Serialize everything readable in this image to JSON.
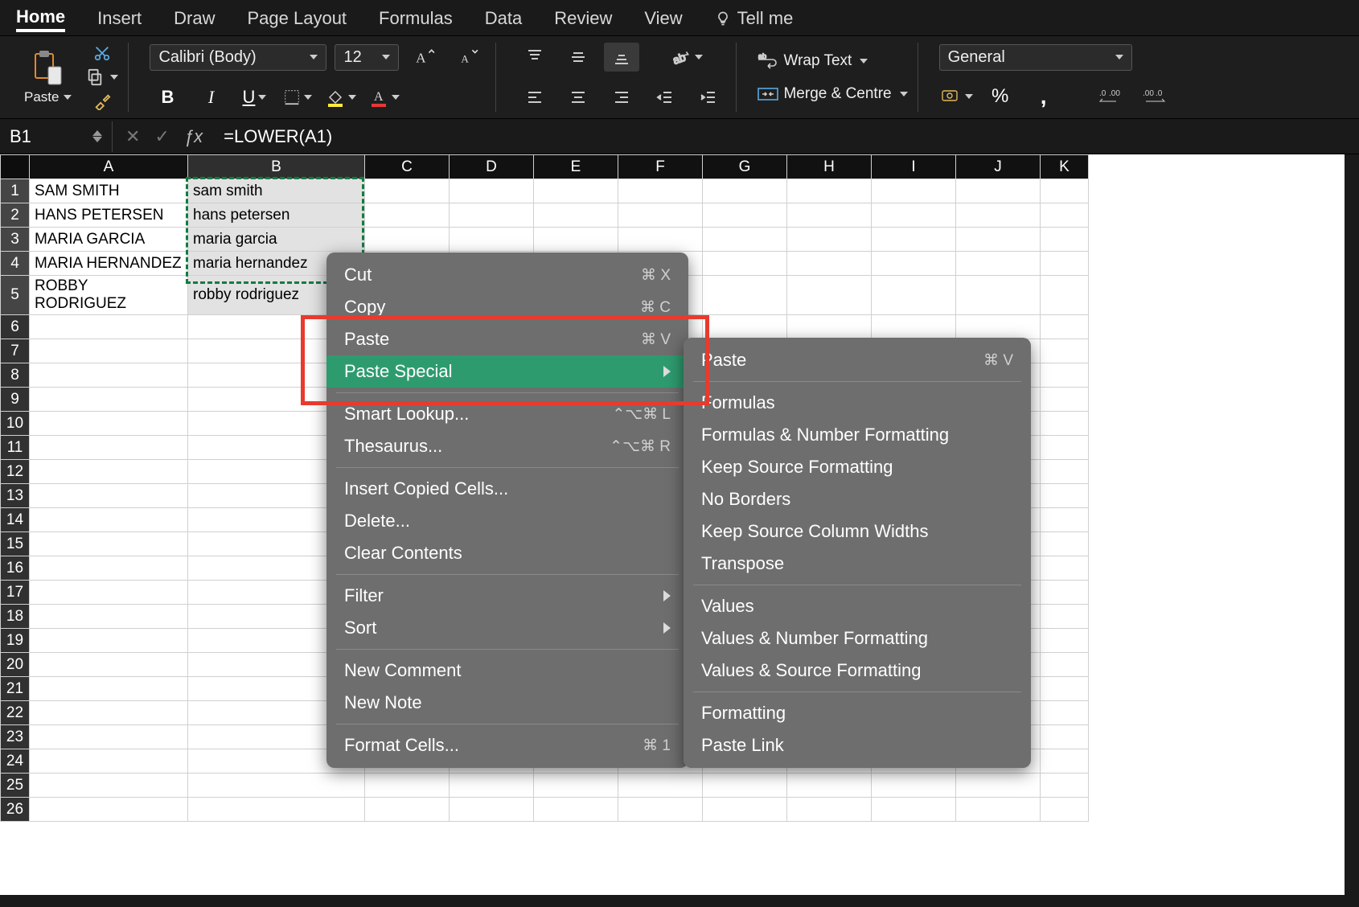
{
  "tabs": {
    "home": "Home",
    "insert": "Insert",
    "draw": "Draw",
    "pageLayout": "Page Layout",
    "formulas": "Formulas",
    "data": "Data",
    "review": "Review",
    "view": "View",
    "tellme": "Tell me"
  },
  "ribbon": {
    "paste": "Paste",
    "font_name": "Calibri (Body)",
    "font_size": "12",
    "wrap": "Wrap Text",
    "merge": "Merge & Centre",
    "number_format": "General"
  },
  "formula_bar": {
    "name_box": "B1",
    "formula": "=LOWER(A1)"
  },
  "columns": [
    "A",
    "B",
    "C",
    "D",
    "E",
    "F",
    "G",
    "H",
    "I",
    "J"
  ],
  "row_count": 26,
  "cells": {
    "A": [
      "SAM SMITH",
      "HANS PETERSEN",
      "MARIA GARCIA",
      "MARIA HERNANDEZ",
      "ROBBY RODRIGUEZ"
    ],
    "B": [
      "sam smith",
      "hans petersen",
      "maria garcia",
      "maria hernandez",
      "robby rodriguez"
    ]
  },
  "context_menu": {
    "cut": "Cut",
    "cut_k": "⌘ X",
    "copy": "Copy",
    "copy_k": "⌘ C",
    "paste": "Paste",
    "paste_k": "⌘ V",
    "paste_special": "Paste Special",
    "smart": "Smart Lookup...",
    "smart_k": "⌃⌥⌘ L",
    "thesaurus": "Thesaurus...",
    "thesaurus_k": "⌃⌥⌘ R",
    "insert_copied": "Insert Copied Cells...",
    "delete": "Delete...",
    "clear": "Clear Contents",
    "filter": "Filter",
    "sort": "Sort",
    "new_comment": "New Comment",
    "new_note": "New Note",
    "format_cells": "Format Cells...",
    "format_cells_k": "⌘ 1"
  },
  "sub_menu": {
    "paste": "Paste",
    "paste_k": "⌘ V",
    "formulas": "Formulas",
    "fnf": "Formulas & Number Formatting",
    "ksf": "Keep Source Formatting",
    "nb": "No Borders",
    "kscw": "Keep Source Column Widths",
    "transpose": "Transpose",
    "values": "Values",
    "vnf": "Values & Number Formatting",
    "vsf": "Values & Source Formatting",
    "formatting": "Formatting",
    "paste_link": "Paste Link"
  }
}
